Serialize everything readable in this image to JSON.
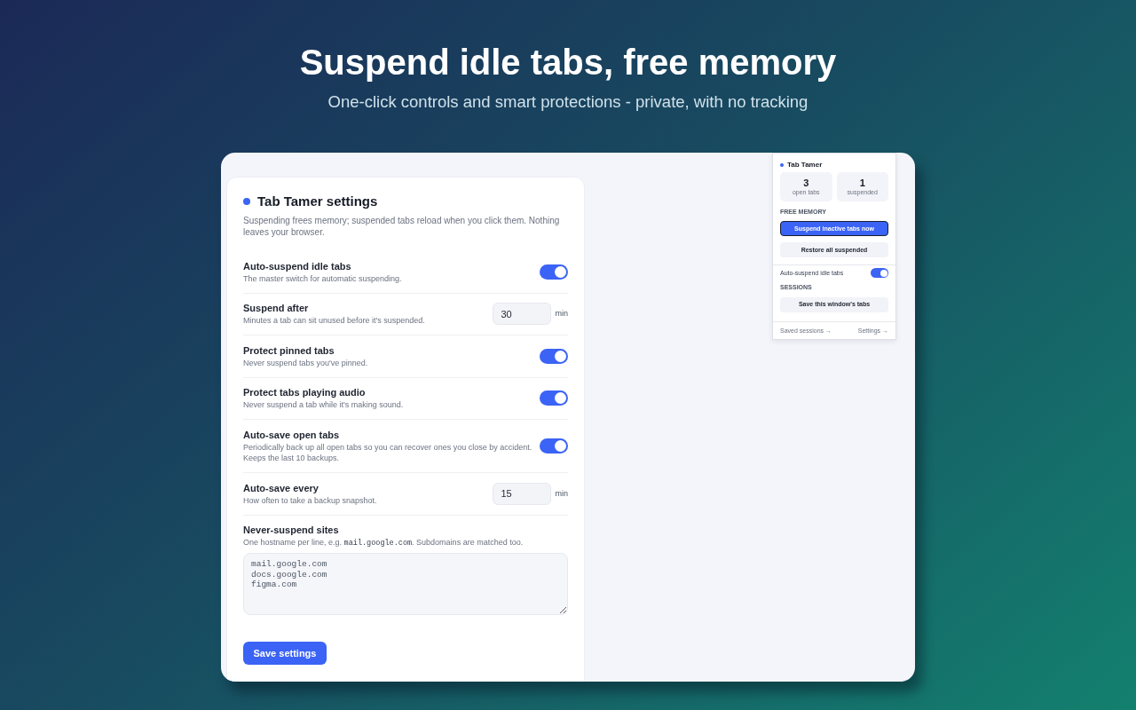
{
  "hero": {
    "title": "Suspend idle tabs, free memory",
    "subtitle": "One-click controls and smart protections - private, with no tracking"
  },
  "settings": {
    "title": "Tab Tamer settings",
    "description": "Suspending frees memory; suspended tabs reload when you click them. Nothing leaves your browser.",
    "rows": [
      {
        "kind": "toggle",
        "label": "Auto-suspend idle tabs",
        "hint": "The master switch for automatic suspending.",
        "on": true
      },
      {
        "kind": "number",
        "label": "Suspend after",
        "hint": "Minutes a tab can sit unused before it's suspended.",
        "value": "30",
        "unit": "min"
      },
      {
        "kind": "toggle",
        "label": "Protect pinned tabs",
        "hint": "Never suspend tabs you've pinned.",
        "on": true
      },
      {
        "kind": "toggle",
        "label": "Protect tabs playing audio",
        "hint": "Never suspend a tab while it's making sound.",
        "on": true
      },
      {
        "kind": "toggle",
        "label": "Auto-save open tabs",
        "hint": "Periodically back up all open tabs so you can recover ones you close by accident. Keeps the last 10 backups.",
        "on": true
      },
      {
        "kind": "number",
        "label": "Auto-save every",
        "hint": "How often to take a backup snapshot.",
        "value": "15",
        "unit": "min"
      },
      {
        "kind": "textarea",
        "label": "Never-suspend sites",
        "hint_parts": [
          {
            "text": "One hostname per line, e.g. ",
            "code": false
          },
          {
            "text": "mail.google.com",
            "code": true
          },
          {
            "text": ". Subdomains are matched too.",
            "code": false
          }
        ],
        "value": "mail.google.com\ndocs.google.com\nfigma.com"
      }
    ],
    "save_button": "Save settings"
  },
  "popup": {
    "title": "Tab Tamer",
    "stats": [
      {
        "value": "3",
        "label": "open tabs"
      },
      {
        "value": "1",
        "label": "suspended"
      }
    ],
    "free_memory_heading": "FREE MEMORY",
    "buttons": [
      {
        "kind": "primary",
        "label": "Suspend inactive tabs now",
        "focused": true
      },
      {
        "kind": "secondary",
        "label": "Restore all suspended",
        "focused": false
      }
    ],
    "toggle": {
      "label": "Auto-suspend idle tabs",
      "on": true
    },
    "sessions_heading": "SESSIONS",
    "session_button": "Save this window's tabs",
    "footer_links": [
      "Saved sessions →",
      "Settings →"
    ]
  }
}
